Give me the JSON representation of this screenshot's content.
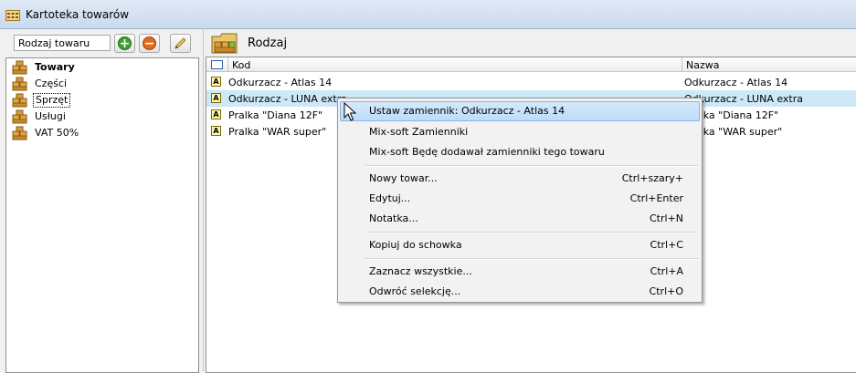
{
  "window": {
    "title": "Kartoteka towarów",
    "app_icon": "folder-grid-icon"
  },
  "left": {
    "field_value": "Rodzaj towaru",
    "buttons": [
      {
        "name": "add",
        "icon": "plus-icon",
        "color": "#3aa12b"
      },
      {
        "name": "remove",
        "icon": "minus-icon",
        "color": "#e06a1a"
      },
      {
        "name": "edit",
        "icon": "pencil-icon"
      }
    ],
    "tree": [
      {
        "label": "Towary",
        "bold": true,
        "selected": false
      },
      {
        "label": "Części",
        "bold": false,
        "selected": false
      },
      {
        "label": "Sprzęt",
        "bold": false,
        "selected": true
      },
      {
        "label": "Usługi",
        "bold": false,
        "selected": false
      },
      {
        "label": "VAT 50%",
        "bold": false,
        "selected": false
      }
    ]
  },
  "right": {
    "title": "Rodzaj",
    "columns": {
      "kod": "Kod",
      "nazwa": "Nazwa"
    },
    "rows": [
      {
        "kod": "Odkurzacz - Atlas 14",
        "nazwa": "Odkurzacz - Atlas 14",
        "selected": false
      },
      {
        "kod": "Odkurzacz - LUNA extra",
        "nazwa": "Odkurzacz - LUNA extra",
        "selected": true
      },
      {
        "kod": "Pralka \"Diana 12F\"",
        "nazwa": "Pralka \"Diana 12F\"",
        "selected": false
      },
      {
        "kod": "Pralka \"WAR super\"",
        "nazwa": "Pralka \"WAR super\"",
        "selected": false
      }
    ]
  },
  "context_menu": {
    "items": [
      {
        "label": "Ustaw zamiennik: Odkurzacz - Atlas 14",
        "shortcut": "",
        "highlighted": true
      },
      {
        "label": "Mix-soft Zamienniki",
        "shortcut": ""
      },
      {
        "label": "Mix-soft Będę dodawał zamienniki tego towaru",
        "shortcut": ""
      },
      {
        "separator": true
      },
      {
        "label": "Nowy towar...",
        "shortcut": "Ctrl+szary+"
      },
      {
        "label": "Edytuj...",
        "shortcut": "Ctrl+Enter"
      },
      {
        "label": "Notatka...",
        "shortcut": "Ctrl+N"
      },
      {
        "separator": true
      },
      {
        "label": "Kopiuj do schowka",
        "shortcut": "Ctrl+C"
      },
      {
        "separator": true
      },
      {
        "label": "Zaznacz wszystkie...",
        "shortcut": "Ctrl+A"
      },
      {
        "label": "Odwróć selekcję...",
        "shortcut": "Ctrl+O"
      }
    ]
  },
  "colors": {
    "selection": "#cde8f6",
    "menu_highlight": "#c4e0fa",
    "titlebar": "#dfe9f5"
  }
}
